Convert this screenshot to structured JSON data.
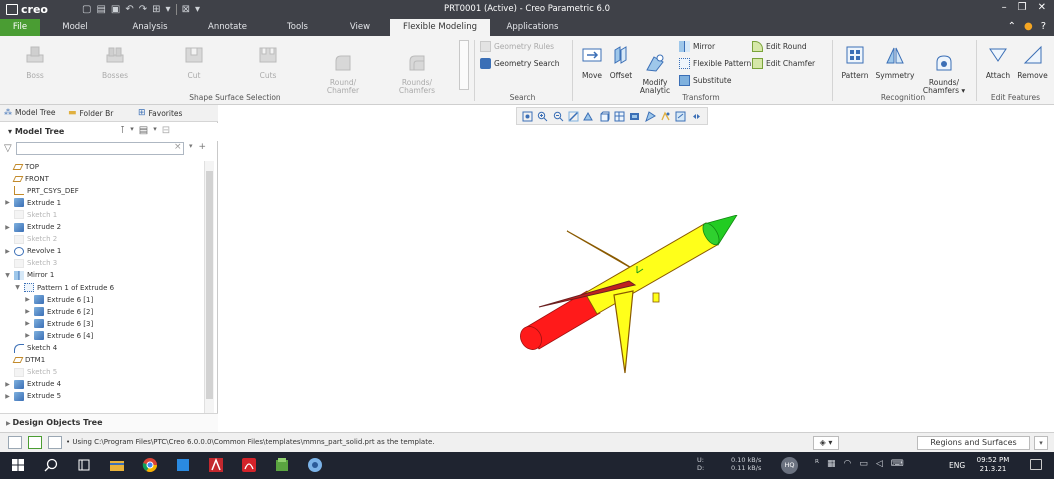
{
  "app": {
    "logo_text": "creo",
    "window_title": "PRT0001 (Active) - Creo Parametric 6.0",
    "accent_color": "#4a9d33",
    "titlebar_color": "#3f4148"
  },
  "ribbon_tabs": [
    "File",
    "Model",
    "Analysis",
    "Annotate",
    "Tools",
    "View",
    "Flexible Modeling",
    "Applications"
  ],
  "ribbon": {
    "shape_surface_selection": {
      "label": "Shape Surface Selection",
      "buttons": [
        "Boss",
        "Bosses",
        "Cut",
        "Cuts",
        "Round/\nChamfer",
        "Rounds/\nChamfers"
      ]
    },
    "search": {
      "label": "Search",
      "geometry_rules": "Geometry Rules",
      "geometry_search": "Geometry Search"
    },
    "transform": {
      "label": "Transform",
      "move": "Move",
      "offset": "Offset",
      "modify_analytic": "Modify\nAnalytic",
      "mirror": "Mirror",
      "flexible_pattern": "Flexible Pattern",
      "substitute": "Substitute",
      "edit_round": "Edit Round",
      "edit_chamfer": "Edit Chamfer"
    },
    "recognition": {
      "label": "Recognition",
      "pattern": "Pattern",
      "symmetry": "Symmetry",
      "rounds_chamfers": "Rounds/\nChamfers ▾"
    },
    "edit_features": {
      "label": "Edit Features",
      "attach": "Attach",
      "remove": "Remove"
    }
  },
  "panel_tabs": [
    "Model Tree",
    "Folder Br",
    "Favorites"
  ],
  "model_tree": {
    "title": "Model Tree",
    "items": [
      {
        "label": "TOP",
        "icon": "datum-plane-icon",
        "indent": 0,
        "expand": "",
        "dim": false
      },
      {
        "label": "FRONT",
        "icon": "datum-plane-icon",
        "indent": 0,
        "expand": "",
        "dim": false
      },
      {
        "label": "PRT_CSYS_DEF",
        "icon": "csys-icon",
        "indent": 0,
        "expand": "",
        "dim": false
      },
      {
        "label": "Extrude 1",
        "icon": "extrude-icon",
        "indent": 0,
        "expand": "▶",
        "dim": false
      },
      {
        "label": "Sketch 1",
        "icon": "sketch-icon",
        "indent": 0,
        "expand": "",
        "dim": true
      },
      {
        "label": "Extrude 2",
        "icon": "extrude-icon",
        "indent": 0,
        "expand": "▶",
        "dim": false
      },
      {
        "label": "Sketch 2",
        "icon": "sketch-icon",
        "indent": 0,
        "expand": "",
        "dim": true
      },
      {
        "label": "Revolve 1",
        "icon": "revolve-icon",
        "indent": 0,
        "expand": "▶",
        "dim": false
      },
      {
        "label": "Sketch 3",
        "icon": "sketch-icon",
        "indent": 0,
        "expand": "",
        "dim": true
      },
      {
        "label": "Mirror 1",
        "icon": "mirror-icon",
        "indent": 0,
        "expand": "▼",
        "dim": false
      },
      {
        "label": "Pattern 1 of Extrude 6",
        "icon": "pattern-icon",
        "indent": 1,
        "expand": "▼",
        "dim": false
      },
      {
        "label": "Extrude 6 [1]",
        "icon": "extrude-icon",
        "indent": 2,
        "expand": "▶",
        "dim": false
      },
      {
        "label": "Extrude 6 [2]",
        "icon": "extrude-icon",
        "indent": 2,
        "expand": "▶",
        "dim": false
      },
      {
        "label": "Extrude 6 [3]",
        "icon": "extrude-icon",
        "indent": 2,
        "expand": "▶",
        "dim": false
      },
      {
        "label": "Extrude 6 [4]",
        "icon": "extrude-icon",
        "indent": 2,
        "expand": "▶",
        "dim": false
      },
      {
        "label": "Sketch 4",
        "icon": "sketch-curve-icon",
        "indent": 0,
        "expand": "",
        "dim": false
      },
      {
        "label": "DTM1",
        "icon": "datum-plane-icon",
        "indent": 0,
        "expand": "",
        "dim": false
      },
      {
        "label": "Sketch 5",
        "icon": "sketch-icon",
        "indent": 0,
        "expand": "",
        "dim": true
      },
      {
        "label": "Extrude 4",
        "icon": "extrude-icon",
        "indent": 0,
        "expand": "▶",
        "dim": false
      },
      {
        "label": "Extrude 5",
        "icon": "extrude-icon",
        "indent": 0,
        "expand": "▶",
        "dim": false
      }
    ]
  },
  "design_objects_tree": "Design Objects Tree",
  "status": {
    "message": "• Using C:\\Program Files\\PTC\\Creo 6.0.0.0\\Common Files\\templates\\mmns_part_solid.prt as the template.",
    "filter_value": "Regions and Surfaces"
  },
  "model_colors": {
    "body": "#ffff1a",
    "nose": "#22cc22",
    "tail": "#ff1a1a",
    "outline": "#8a5a00"
  },
  "taskbar": {
    "net_labels": "U:\nD:",
    "net_rates": "0.10 kB/s\n0.11 kB/s",
    "hq_badge": "HQ",
    "language": "ENG",
    "time": "09:52 PM",
    "date": "21.3.21"
  }
}
